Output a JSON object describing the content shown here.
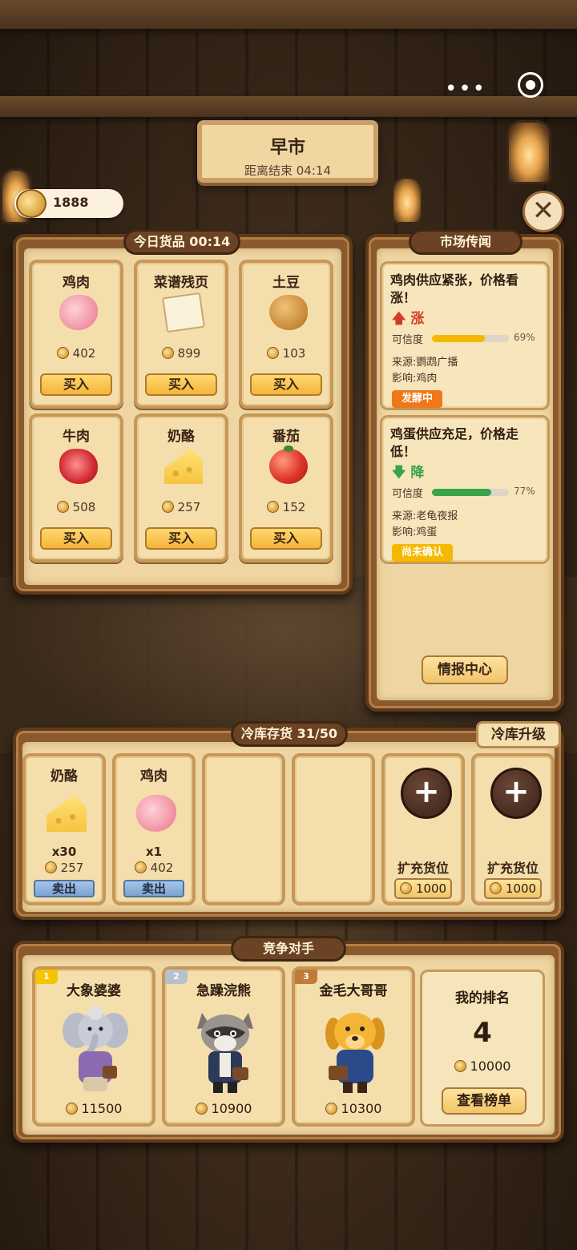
{
  "header": {
    "session_title": "早市",
    "countdown": "距离结束 04:14",
    "coins": "1888"
  },
  "shop": {
    "tab": "今日货品 00:14",
    "buy_label": "买入",
    "items": [
      {
        "name": "鸡肉",
        "price": "402",
        "icon": "chicken-meat-icon"
      },
      {
        "name": "菜谱残页",
        "price": "899",
        "icon": "recipe-page-icon"
      },
      {
        "name": "土豆",
        "price": "103",
        "icon": "potato-icon"
      },
      {
        "name": "牛肉",
        "price": "508",
        "icon": "beef-icon"
      },
      {
        "name": "奶酪",
        "price": "257",
        "icon": "cheese-icon"
      },
      {
        "name": "番茄",
        "price": "152",
        "icon": "tomato-icon"
      }
    ]
  },
  "rumors": {
    "tab": "市场传闻",
    "cred_label": "可信度",
    "items": [
      {
        "headline": "鸡肉供应紧张，价格看涨！",
        "trend": "涨",
        "credibility": 0.69,
        "credibility_text": "69%",
        "source": "来源:鹦鹉广播",
        "effect": "影响:鸡肉",
        "status": "发酵中",
        "color": "#f5b800",
        "trend_color": "#d23b2a",
        "status_color": "#f07818"
      },
      {
        "headline": "鸡蛋供应充足，价格走低！",
        "trend": "降",
        "credibility": 0.77,
        "credibility_text": "77%",
        "source": "来源:老龟夜报",
        "effect": "影响:鸡蛋",
        "status": "尚未确认",
        "color": "#3aa34a",
        "trend_color": "#3aa34a",
        "status_color": "#f5b800"
      }
    ],
    "intel_button": "情报中心"
  },
  "storage": {
    "tab": "冷库存货 31/50",
    "upgrade_button": "冷库升级",
    "sell_label": "卖出",
    "slots": [
      {
        "name": "奶酪",
        "qty": "x30",
        "price": "257",
        "icon": "cheese-icon"
      },
      {
        "name": "鸡肉",
        "qty": "x1",
        "price": "402",
        "icon": "chicken-meat-icon"
      }
    ],
    "expand_label": "扩充货位",
    "expand_cost": "1000"
  },
  "rivals": {
    "tab": "竞争对手",
    "list": [
      {
        "rank": "1",
        "name": "大象婆婆",
        "coins": "11500",
        "icon": "elephant-avatar-icon",
        "tag_color": "#f5c400"
      },
      {
        "rank": "2",
        "name": "急躁浣熊",
        "coins": "10900",
        "icon": "raccoon-avatar-icon",
        "tag_color": "#b8c0cc"
      },
      {
        "rank": "3",
        "name": "金毛大哥哥",
        "coins": "10300",
        "icon": "golden-retriever-avatar-icon",
        "tag_color": "#c27a3c"
      }
    ],
    "my_rank_label": "我的排名",
    "my_rank": "4",
    "my_coins": "10000",
    "leaderboard_button": "查看榜单"
  }
}
